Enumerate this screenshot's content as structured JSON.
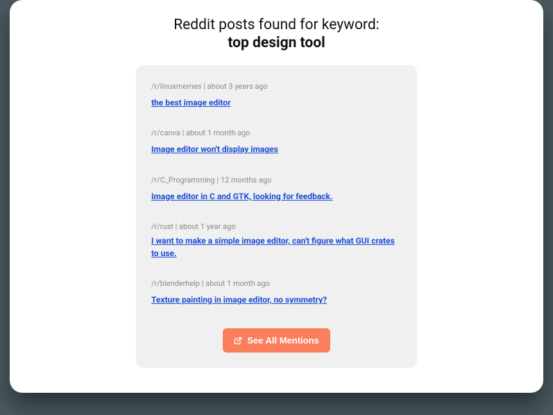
{
  "heading": {
    "line1": "Reddit posts found for keyword:",
    "keyword": "top design tool"
  },
  "posts": [
    {
      "subreddit": "/r/linuxmemes",
      "time": "about 3 years ago",
      "title": "the best image editor"
    },
    {
      "subreddit": "/r/canva",
      "time": "about 1 month ago",
      "title": "Image editor won't display images"
    },
    {
      "subreddit": "/r/C_Programming",
      "time": "12 months ago",
      "title": "Image editor in C and GTK, looking for feedback."
    },
    {
      "subreddit": "/r/rust",
      "time": "about 1 year ago",
      "title": "I want to make a simple image editor, can't figure what GUI crates to use."
    },
    {
      "subreddit": "/r/blenderhelp",
      "time": "about 1 month ago",
      "title": "Texture painting in image editor, no symmetry?"
    }
  ],
  "button": {
    "label": "See All Mentions"
  }
}
